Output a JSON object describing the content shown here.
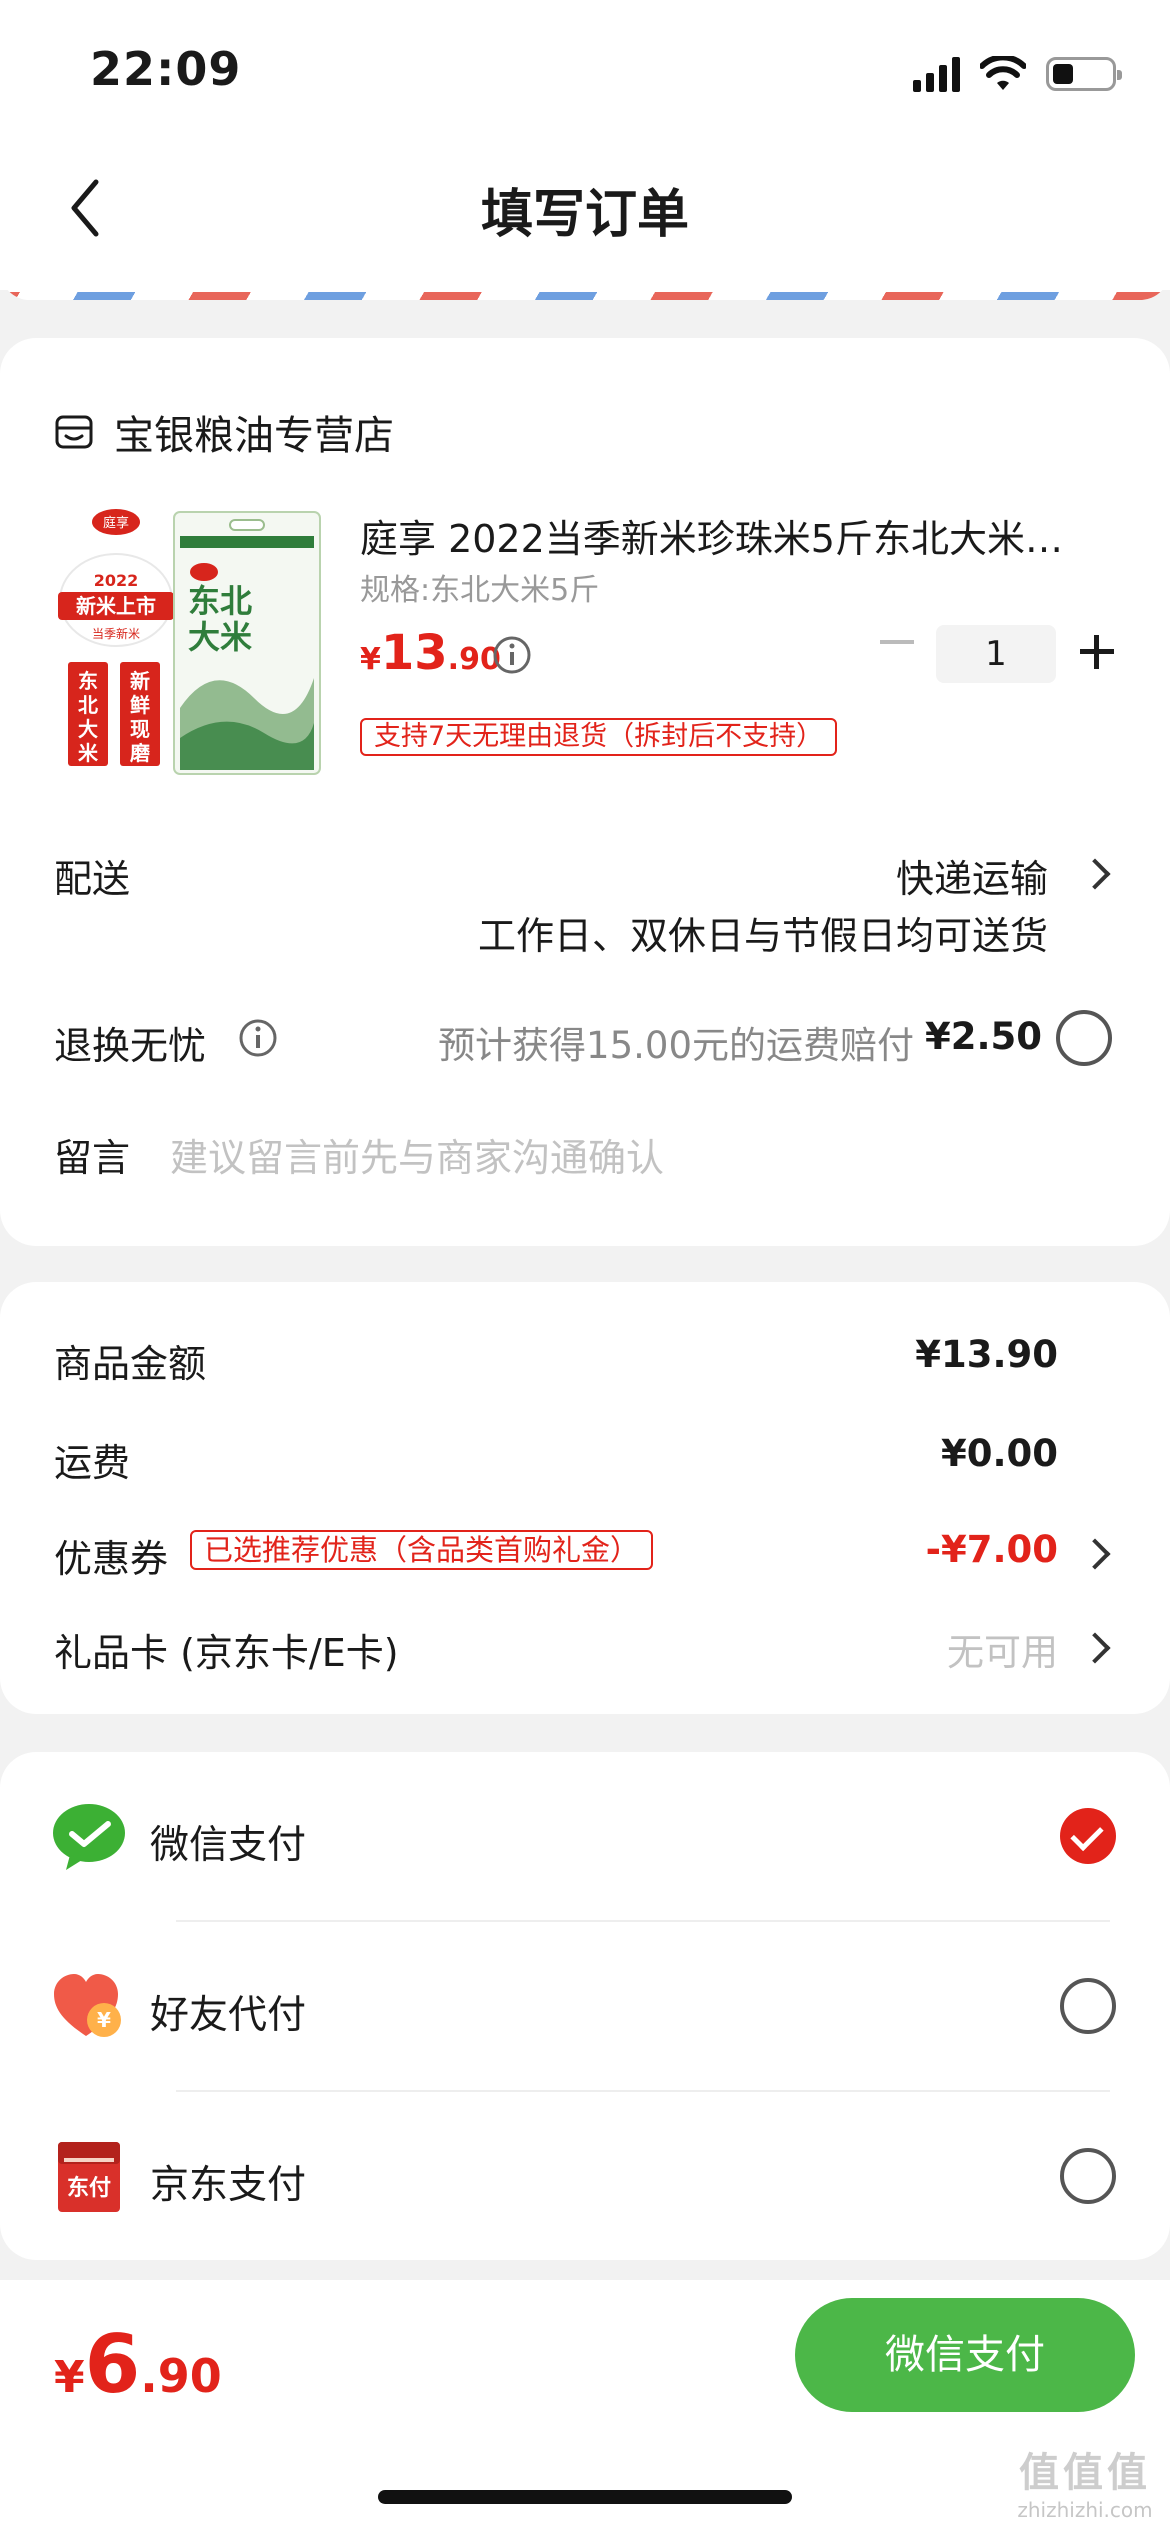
{
  "status_bar": {
    "time": "22:09",
    "battery_level": 0.35
  },
  "nav": {
    "title": "填写订单"
  },
  "shop": {
    "name": "宝银粮油专营店",
    "icon": "store-icon"
  },
  "product": {
    "title": "庭享 2022当季新米珍珠米5斤东北大米…",
    "spec": "规格:东北大米5斤",
    "price_currency": "¥",
    "price_int": "13",
    "price_dec": ".90",
    "quantity": "1",
    "return_policy": "支持7天无理由退货（拆封后不支持）",
    "image_texts": {
      "brand": "庭享",
      "year": "2022",
      "banner": "新米上市",
      "sub_banner": "当季新米",
      "tag_left": "东北大米",
      "tag_right": "新鲜现磨",
      "bag_title": "东北大米"
    }
  },
  "delivery": {
    "label": "配送",
    "method": "快递运输",
    "note": "工作日、双休日与节假日均可送货"
  },
  "worry_free": {
    "label": "退换无忧",
    "text": "预计获得15.00元的运费赔付",
    "price": "¥2.50"
  },
  "message": {
    "label": "留言",
    "placeholder": "建议留言前先与商家沟通确认"
  },
  "summary": {
    "goods_label": "商品金额",
    "goods_amount": "¥13.90",
    "shipping_label": "运费",
    "shipping_amount": "¥0.00",
    "coupon_label": "优惠券",
    "coupon_tag": "已选推荐优惠（含品类首购礼金）",
    "coupon_amount": "-¥7.00",
    "giftcard_label": "礼品卡 (京东卡/E卡)",
    "giftcard_value": "无可用"
  },
  "payment": {
    "options": [
      {
        "label": "微信支付",
        "icon": "wechat-pay-icon",
        "selected": true
      },
      {
        "label": "好友代付",
        "icon": "friend-pay-icon",
        "selected": false
      },
      {
        "label": "京东支付",
        "icon": "jd-pay-icon",
        "selected": false
      }
    ],
    "jd_icon_text": "东付",
    "friend_icon_text": "¥"
  },
  "footer": {
    "total_currency": "¥",
    "total_int": "6",
    "total_dec": ".90",
    "pay_button_label": "微信支付",
    "watermark_main": "值值值",
    "watermark_sub": "zhizhizhi.com"
  },
  "colors": {
    "accent_red": "#e2231a",
    "wechat_green": "#4cb748"
  }
}
